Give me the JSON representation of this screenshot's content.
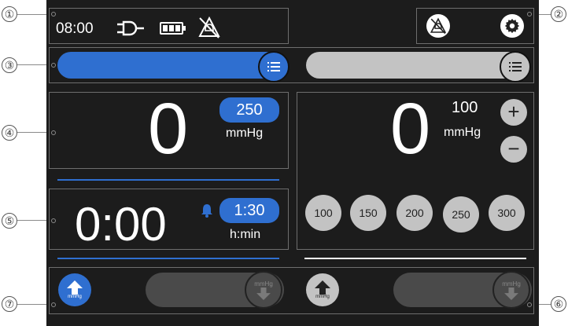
{
  "status": {
    "time": "08:00",
    "icons": [
      "power-plug-icon",
      "battery-icon",
      "alarm-muted-icon"
    ]
  },
  "callouts": {
    "c1": "①",
    "c2": "②",
    "c3": "③",
    "c4": "④",
    "c5": "⑤",
    "c6": "⑥",
    "c7": "⑦"
  },
  "left_channel": {
    "pressure_value": "0",
    "target_value": "250",
    "unit": "mmHg",
    "timer_value": "0:00",
    "timer_target": "1:30",
    "timer_unit": "h:min",
    "inflate_unit": "mmHg",
    "deflate_unit": "mmHg",
    "bar_color": "#2f6fd0"
  },
  "right_channel": {
    "pressure_value": "0",
    "target_value": "100",
    "unit": "mmHg",
    "plus_label": "+",
    "minus_label": "−",
    "presets": [
      "100",
      "150",
      "200",
      "250",
      "300"
    ],
    "inflate_unit": "mmHg",
    "deflate_unit": "mmHg",
    "bar_color": "#c3c3c3"
  }
}
